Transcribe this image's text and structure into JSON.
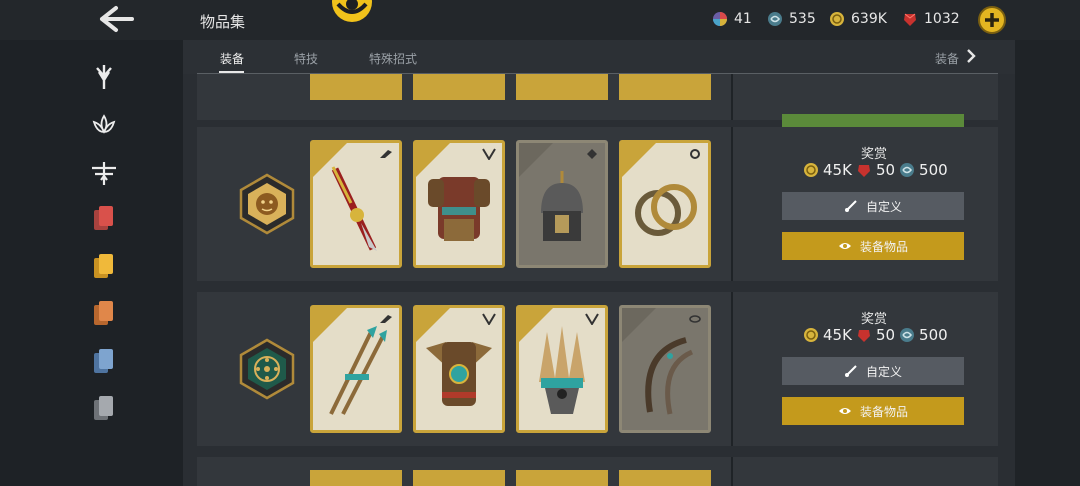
{
  "header": {
    "title": "物品集",
    "currencies": [
      {
        "icon": "multicolor-orb-icon",
        "value": "41"
      },
      {
        "icon": "steel-swirl-icon",
        "value": "535"
      },
      {
        "icon": "coin-icon",
        "value": "639K"
      },
      {
        "icon": "red-gem-icon",
        "value": "1032"
      }
    ]
  },
  "sidebar": {
    "items": [
      {
        "icon": "knight-faction-icon"
      },
      {
        "icon": "lotus-faction-icon"
      },
      {
        "icon": "dragonfly-faction-icon"
      },
      {
        "icon": "red-cards-icon"
      },
      {
        "icon": "yellow-cards-icon"
      },
      {
        "icon": "orange-cards-icon"
      },
      {
        "icon": "blue-cards-icon"
      },
      {
        "icon": "gray-cards-icon"
      }
    ]
  },
  "tabs": {
    "items": [
      "装备",
      "特技",
      "特殊招式"
    ],
    "active": 0,
    "more_label": "装备"
  },
  "sets": [
    {
      "emblem": "lion-emblem-icon",
      "reward_label": "奖赏",
      "rewards": [
        {
          "icon": "coin-icon",
          "value": "45K"
        },
        {
          "icon": "red-gem-icon",
          "value": "50"
        },
        {
          "icon": "steel-swirl-icon",
          "value": "500"
        }
      ],
      "customize_label": "自定义",
      "equip_label": "装备物品",
      "items": [
        {
          "name": "sword",
          "type_icon": "weapon-type-icon"
        },
        {
          "name": "chest-armor",
          "type_icon": "chest-type-icon"
        },
        {
          "name": "helmet",
          "type_icon": "helm-type-icon"
        },
        {
          "name": "rings",
          "type_icon": "ornament-type-icon"
        }
      ]
    },
    {
      "emblem": "sun-emblem-icon",
      "reward_label": "奖赏",
      "rewards": [
        {
          "icon": "coin-icon",
          "value": "45K"
        },
        {
          "icon": "red-gem-icon",
          "value": "50"
        },
        {
          "icon": "steel-swirl-icon",
          "value": "500"
        }
      ],
      "customize_label": "自定义",
      "equip_label": "装备物品",
      "items": [
        {
          "name": "dual-spears",
          "type_icon": "weapon-type-icon"
        },
        {
          "name": "feather-armor",
          "type_icon": "chest-type-icon"
        },
        {
          "name": "feather-headdress",
          "type_icon": "helm-type-icon"
        },
        {
          "name": "claw-blades",
          "type_icon": "ornament-type-icon"
        }
      ]
    }
  ],
  "colors": {
    "gold": "#c9a43a",
    "equip_button": "#c49a1c",
    "custom_button": "#565b62"
  }
}
